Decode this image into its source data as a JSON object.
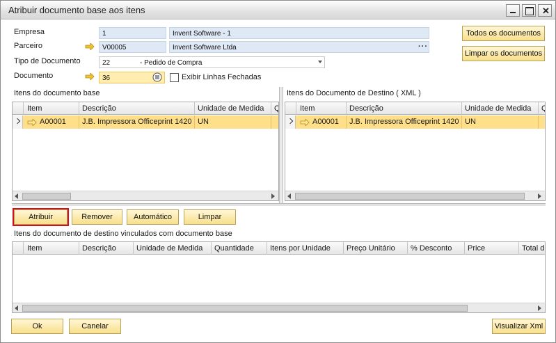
{
  "window": {
    "title": "Atribuir documento base aos itens",
    "close_glyph": "✕"
  },
  "form": {
    "empresa_label": "Empresa",
    "empresa_code": "1",
    "empresa_name": "Invent Software - 1",
    "parceiro_label": "Parceiro",
    "parceiro_code": "V00005",
    "parceiro_name": "Invent Software Ltda",
    "parceiro_more": "···",
    "tipo_label": "Tipo de Documento",
    "tipo_value": "22",
    "tipo_desc": "- Pedido de Compra",
    "documento_label": "Documento",
    "documento_value": "36",
    "exibir_label": "Exibir Linhas Fechadas"
  },
  "actions": {
    "todos": "Todos os documentos",
    "limpar_docs": "Limpar os documentos"
  },
  "base_grid": {
    "title": "Itens do documento base",
    "columns": [
      "Item",
      "Descrição",
      "Unidade de Medida",
      "Qua"
    ],
    "rows": [
      {
        "item": "A00001",
        "descricao": "J.B. Impressora Officeprint 1420",
        "unidade": "UN"
      }
    ]
  },
  "dest_grid": {
    "title": "Itens do Documento de Destino ( XML )",
    "columns": [
      "Item",
      "Descrição",
      "Unidade de Medida",
      "Q"
    ],
    "rows": [
      {
        "item": "A00001",
        "descricao": "J.B. Impressora Officeprint 1420",
        "unidade": "UN"
      }
    ]
  },
  "mid_buttons": {
    "atribuir": "Atribuir",
    "remover": "Remover",
    "automatico": "Automático",
    "limpar": "Limpar"
  },
  "linked_grid": {
    "title": "Itens do documento de destino vinculados com documento base",
    "columns": [
      "Item",
      "Descrição",
      "Unidade de Medida",
      "Quantidade",
      "Itens por Unidade",
      "Preço Unitário",
      "% Desconto",
      "Price",
      "Total d"
    ]
  },
  "footer": {
    "ok": "Ok",
    "cancelar": "Canelar",
    "visualizar": "Visualizar Xml"
  },
  "colors": {
    "accent_yellow": "#f8df8a",
    "row_highlight": "#ffdf8a",
    "field_blue": "#dfe9f6",
    "highlight_red": "#d0101e"
  }
}
